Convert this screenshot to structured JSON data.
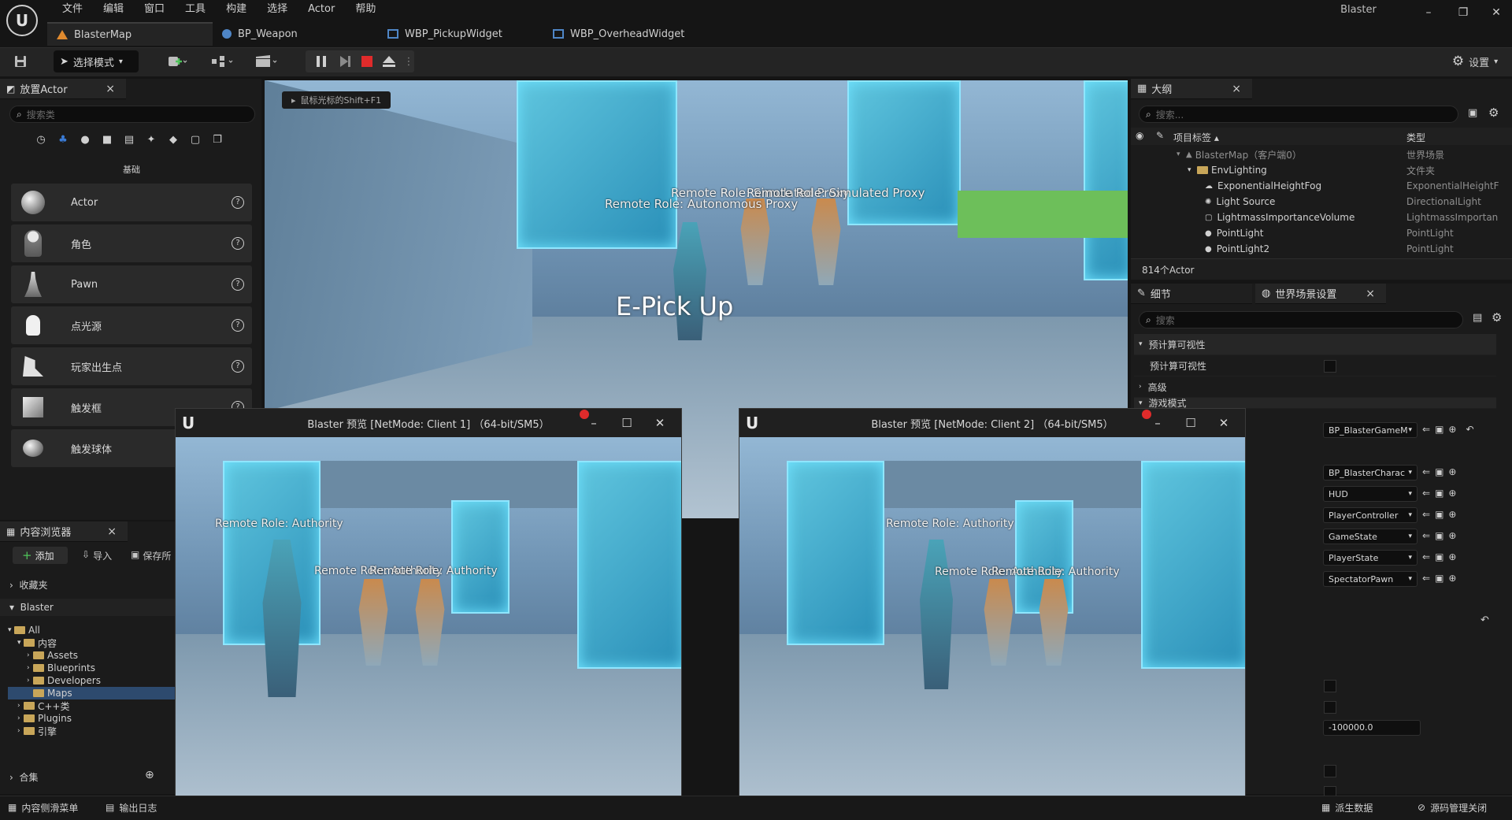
{
  "menu": {
    "items": [
      "文件",
      "编辑",
      "窗口",
      "工具",
      "构建",
      "选择",
      "Actor",
      "帮助"
    ]
  },
  "window": {
    "title": "Blaster",
    "minimize": "–",
    "restore": "❐",
    "close": "✕"
  },
  "tabs": [
    {
      "label": "BlasterMap",
      "active": true,
      "icon_color": "#e08a2e"
    },
    {
      "label": "BP_Weapon",
      "icon_color": "#4f86c6"
    },
    {
      "label": "WBP_PickupWidget",
      "icon_color": "#4f86c6"
    },
    {
      "label": "WBP_OverheadWidget",
      "icon_color": "#4f86c6"
    }
  ],
  "toolbar": {
    "mode_label": "选择模式",
    "settings_label": "设置"
  },
  "place_actors": {
    "title": "放置Actor",
    "search_placeholder": "搜索类",
    "category_label": "基础",
    "items": [
      {
        "label": "Actor",
        "help": "?"
      },
      {
        "label": "角色",
        "help": "?"
      },
      {
        "label": "Pawn",
        "help": "?"
      },
      {
        "label": "点光源",
        "help": "?"
      },
      {
        "label": "玩家出生点",
        "help": "?"
      },
      {
        "label": "触发框",
        "help": "?"
      },
      {
        "label": "触发球体",
        "help": "?"
      }
    ]
  },
  "content_browser": {
    "title": "内容浏览器",
    "add_label": "添加",
    "import_label": "导入",
    "save_label": "保存所",
    "favorites_label": "收藏夹",
    "project_label": "Blaster",
    "tree": [
      "All",
      "内容",
      "Assets",
      "Blueprints",
      "Developers",
      "Maps",
      "C++类",
      "Plugins",
      "引擎"
    ],
    "collections_label": "合集"
  },
  "viewport": {
    "hint": "鼠标光标的Shift+F1",
    "overheads": [
      "Remote Role: Simulated Proxy",
      "Remote Role: Simulated Proxy",
      "Remote Role: Autonomous Proxy"
    ],
    "pickup_text": "E-Pick Up"
  },
  "pie1": {
    "title": "Blaster 预览 [NetMode: Client 1]  （64-bit/SM5）",
    "overheads": [
      "Remote Role: Authority",
      "Remote Role: Authority",
      "Remote Role: Authority"
    ]
  },
  "pie2": {
    "title": "Blaster 预览 [NetMode: Client 2]  （64-bit/SM5）",
    "overheads": [
      "Remote Role: Authority",
      "Remote Role: Authority",
      "Remote Role: Authority"
    ]
  },
  "outliner": {
    "title": "大纲",
    "search_placeholder": "搜索...",
    "col_label": "项目标签",
    "col_type": "类型",
    "rows": [
      {
        "label": "BlasterMap（客户端0）",
        "type": "世界场景",
        "indent": 1
      },
      {
        "label": "EnvLighting",
        "type": "文件夹",
        "indent": 2
      },
      {
        "label": "ExponentialHeightFog",
        "type": "ExponentialHeightF",
        "indent": 3
      },
      {
        "label": "Light Source",
        "type": "DirectionalLight",
        "indent": 3
      },
      {
        "label": "LightmassImportanceVolume",
        "type": "LightmassImportan",
        "indent": 3
      },
      {
        "label": "PointLight",
        "type": "PointLight",
        "indent": 3
      },
      {
        "label": "PointLight2",
        "type": "PointLight",
        "indent": 3
      }
    ],
    "count": "814个Actor"
  },
  "details": {
    "tab1": "细节",
    "tab2": "世界场景设置",
    "search_placeholder": "搜索",
    "section1": "预计算可视性",
    "row1": "预计算可视性",
    "section2": "高级",
    "section3": "游戏模式",
    "combos": [
      "BP_BlasterGameM",
      "BP_BlasterCharac",
      "HUD",
      "PlayerController",
      "GameState",
      "PlayerState",
      "SpectatorPawn"
    ],
    "kill_z": "-100000.0"
  },
  "status": {
    "drawer": "内容侧滑菜单",
    "output_log": "输出日志",
    "derived_data": "派生数据",
    "source_control": "源码管理关闭"
  }
}
